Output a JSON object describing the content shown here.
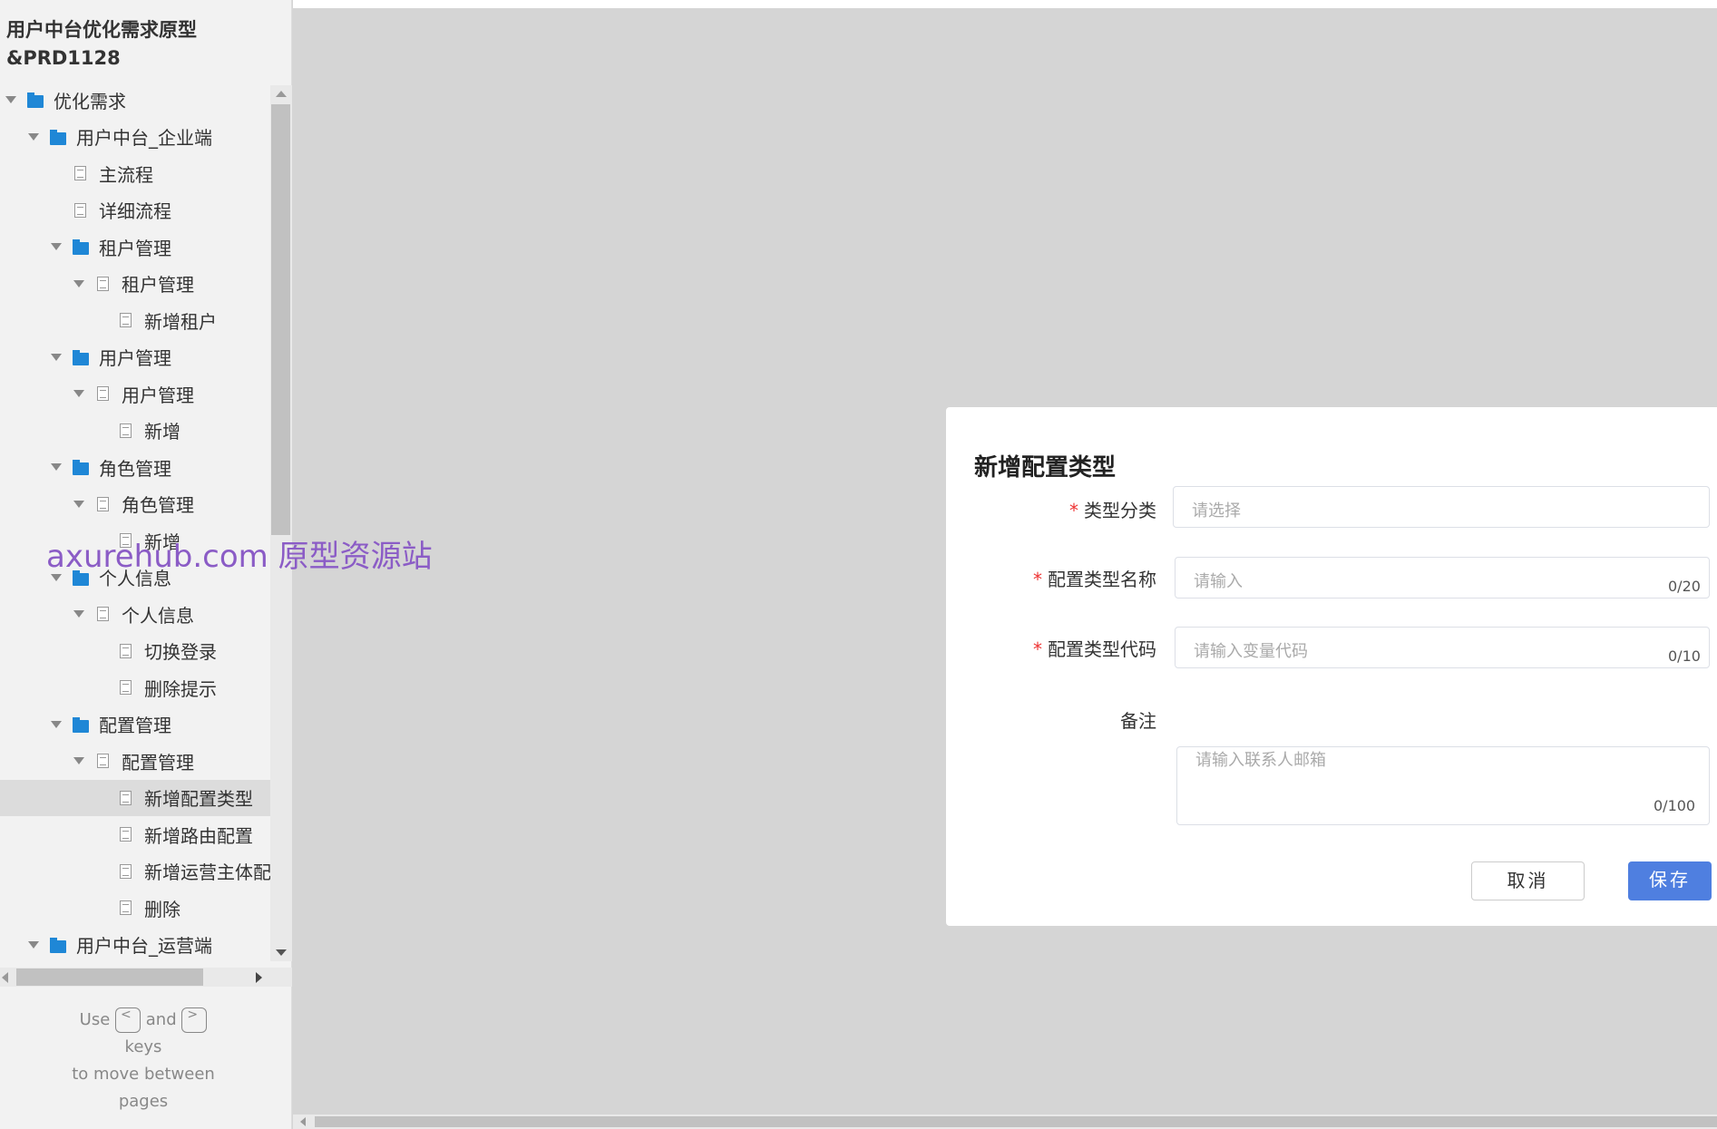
{
  "sidebar": {
    "project_title_line1": "用户中台优化需求原型",
    "project_title_line2": "&PRD1128",
    "tree": [
      {
        "label": "优化需求",
        "type": "folder",
        "level": 0,
        "expanded": true
      },
      {
        "label": "用户中台_企业端",
        "type": "folder",
        "level": 1,
        "expanded": true
      },
      {
        "label": "主流程",
        "type": "page",
        "level": 2
      },
      {
        "label": "详细流程",
        "type": "page",
        "level": 2
      },
      {
        "label": "租户管理",
        "type": "folder",
        "level": 2,
        "expanded": true
      },
      {
        "label": "租户管理",
        "type": "page",
        "level": 3,
        "expanded": true
      },
      {
        "label": "新增租户",
        "type": "page",
        "level": 4
      },
      {
        "label": "用户管理",
        "type": "folder",
        "level": 2,
        "expanded": true
      },
      {
        "label": "用户管理",
        "type": "page",
        "level": 3,
        "expanded": true
      },
      {
        "label": "新增",
        "type": "page",
        "level": 4
      },
      {
        "label": "角色管理",
        "type": "folder",
        "level": 2,
        "expanded": true
      },
      {
        "label": "角色管理",
        "type": "page",
        "level": 3,
        "expanded": true
      },
      {
        "label": "新增",
        "type": "page",
        "level": 4
      },
      {
        "label": "个人信息",
        "type": "folder",
        "level": 2,
        "expanded": true
      },
      {
        "label": "个人信息",
        "type": "page",
        "level": 3,
        "expanded": true
      },
      {
        "label": "切换登录",
        "type": "page",
        "level": 4
      },
      {
        "label": "删除提示",
        "type": "page",
        "level": 4
      },
      {
        "label": "配置管理",
        "type": "folder",
        "level": 2,
        "expanded": true
      },
      {
        "label": "配置管理",
        "type": "page",
        "level": 3,
        "expanded": true
      },
      {
        "label": "新增配置类型",
        "type": "page",
        "level": 4,
        "selected": true
      },
      {
        "label": "新增路由配置",
        "type": "page",
        "level": 4
      },
      {
        "label": "新增运营主体配置",
        "type": "page",
        "level": 4
      },
      {
        "label": "删除",
        "type": "page",
        "level": 4
      },
      {
        "label": "用户中台_运营端",
        "type": "folder",
        "level": 1,
        "expanded": true
      }
    ],
    "help": {
      "use": "Use",
      "prev_key": "<",
      "and": "and",
      "next_key": ">",
      "keys": "keys",
      "line3": "to move between",
      "line4": "pages"
    }
  },
  "watermark": "axurehub.com 原型资源站",
  "dialog": {
    "title": "新增配置类型",
    "fields": [
      {
        "label": "类型分类",
        "required": true,
        "placeholder": "请选择",
        "counter": ""
      },
      {
        "label": "配置类型名称",
        "required": true,
        "placeholder": "请输入",
        "counter": "0/20"
      },
      {
        "label": "配置类型代码",
        "required": true,
        "placeholder": "请输入变量代码",
        "counter": "0/10"
      },
      {
        "label": "备注",
        "required": false,
        "placeholder": "请输入联系人邮箱",
        "counter": "0/100"
      }
    ],
    "cancel_label": "取消",
    "save_label": "保存"
  },
  "colors": {
    "accent": "#4f7fe0",
    "folder": "#1f87d6",
    "required": "#e33333",
    "watermark": "#8b5cc6"
  }
}
